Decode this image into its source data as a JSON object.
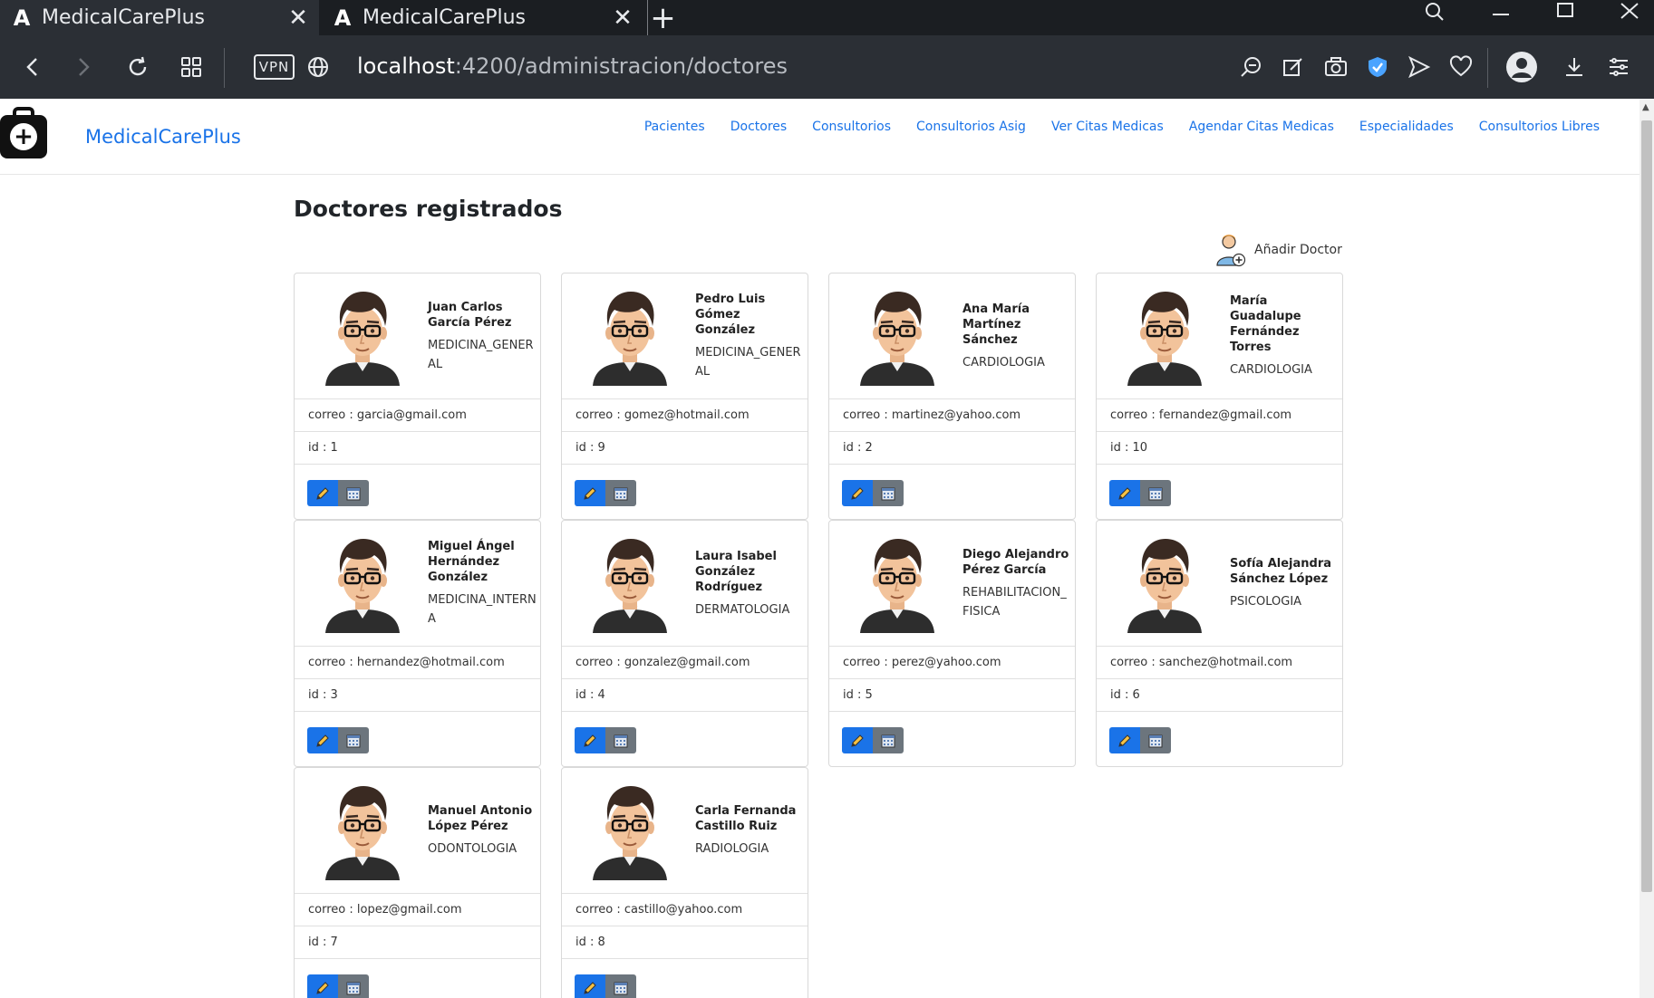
{
  "browser": {
    "tabs": [
      {
        "title": "MedicalCarePlus",
        "active": true
      },
      {
        "title": "MedicalCarePlus",
        "active": false
      }
    ],
    "new_tab": "+",
    "vpn_label": "VPN",
    "url_host": "localhost",
    "url_path": ":4200/administracion/doctores"
  },
  "app": {
    "brand": "MedicalCarePlus",
    "nav": [
      "Pacientes",
      "Doctores",
      "Consultorios",
      "Consultorios Asig",
      "Ver Citas Medicas",
      "Agendar Citas Medicas",
      "Especialidades",
      "Consultorios Libres"
    ],
    "page_title": "Doctores registrados",
    "add_doctor_label": "Añadir Doctor"
  },
  "doctors": [
    {
      "name": "Juan Carlos García Pérez",
      "specialty": "MEDICINA_GENERAL",
      "correo": "correo : garcia@gmail.com",
      "id": "id : 1"
    },
    {
      "name": "Pedro Luis Gómez González",
      "specialty": "MEDICINA_GENERAL",
      "correo": "correo : gomez@hotmail.com",
      "id": "id : 9"
    },
    {
      "name": "Ana María Martínez Sánchez",
      "specialty": "CARDIOLOGIA",
      "correo": "correo : martinez@yahoo.com",
      "id": "id : 2"
    },
    {
      "name": "María Guadalupe Fernández Torres",
      "specialty": "CARDIOLOGIA",
      "correo": "correo : fernandez@gmail.com",
      "id": "id : 10"
    },
    {
      "name": "Miguel Ángel Hernández González",
      "specialty": "MEDICINA_INTERNA",
      "correo": "correo : hernandez@hotmail.com",
      "id": "id : 3"
    },
    {
      "name": "Laura Isabel González Rodríguez",
      "specialty": "DERMATOLOGIA",
      "correo": "correo : gonzalez@gmail.com",
      "id": "id : 4"
    },
    {
      "name": "Diego Alejandro Pérez García",
      "specialty": "REHABILITACION_FISICA",
      "correo": "correo : perez@yahoo.com",
      "id": "id : 5"
    },
    {
      "name": "Sofía Alejandra Sánchez López",
      "specialty": "PSICOLOGIA",
      "correo": "correo : sanchez@hotmail.com",
      "id": "id : 6"
    },
    {
      "name": "Manuel Antonio López Pérez",
      "specialty": "ODONTOLOGIA",
      "correo": "correo : lopez@gmail.com",
      "id": "id : 7"
    },
    {
      "name": "Carla Fernanda Castillo Ruiz",
      "specialty": "RADIOLOGIA",
      "correo": "correo : castillo@yahoo.com",
      "id": "id : 8"
    }
  ],
  "colors": {
    "accent": "#1a73e8",
    "secondary": "#6c757d",
    "chrome_dark": "#1b1e22",
    "chrome_toolbar": "#2b2f35"
  }
}
